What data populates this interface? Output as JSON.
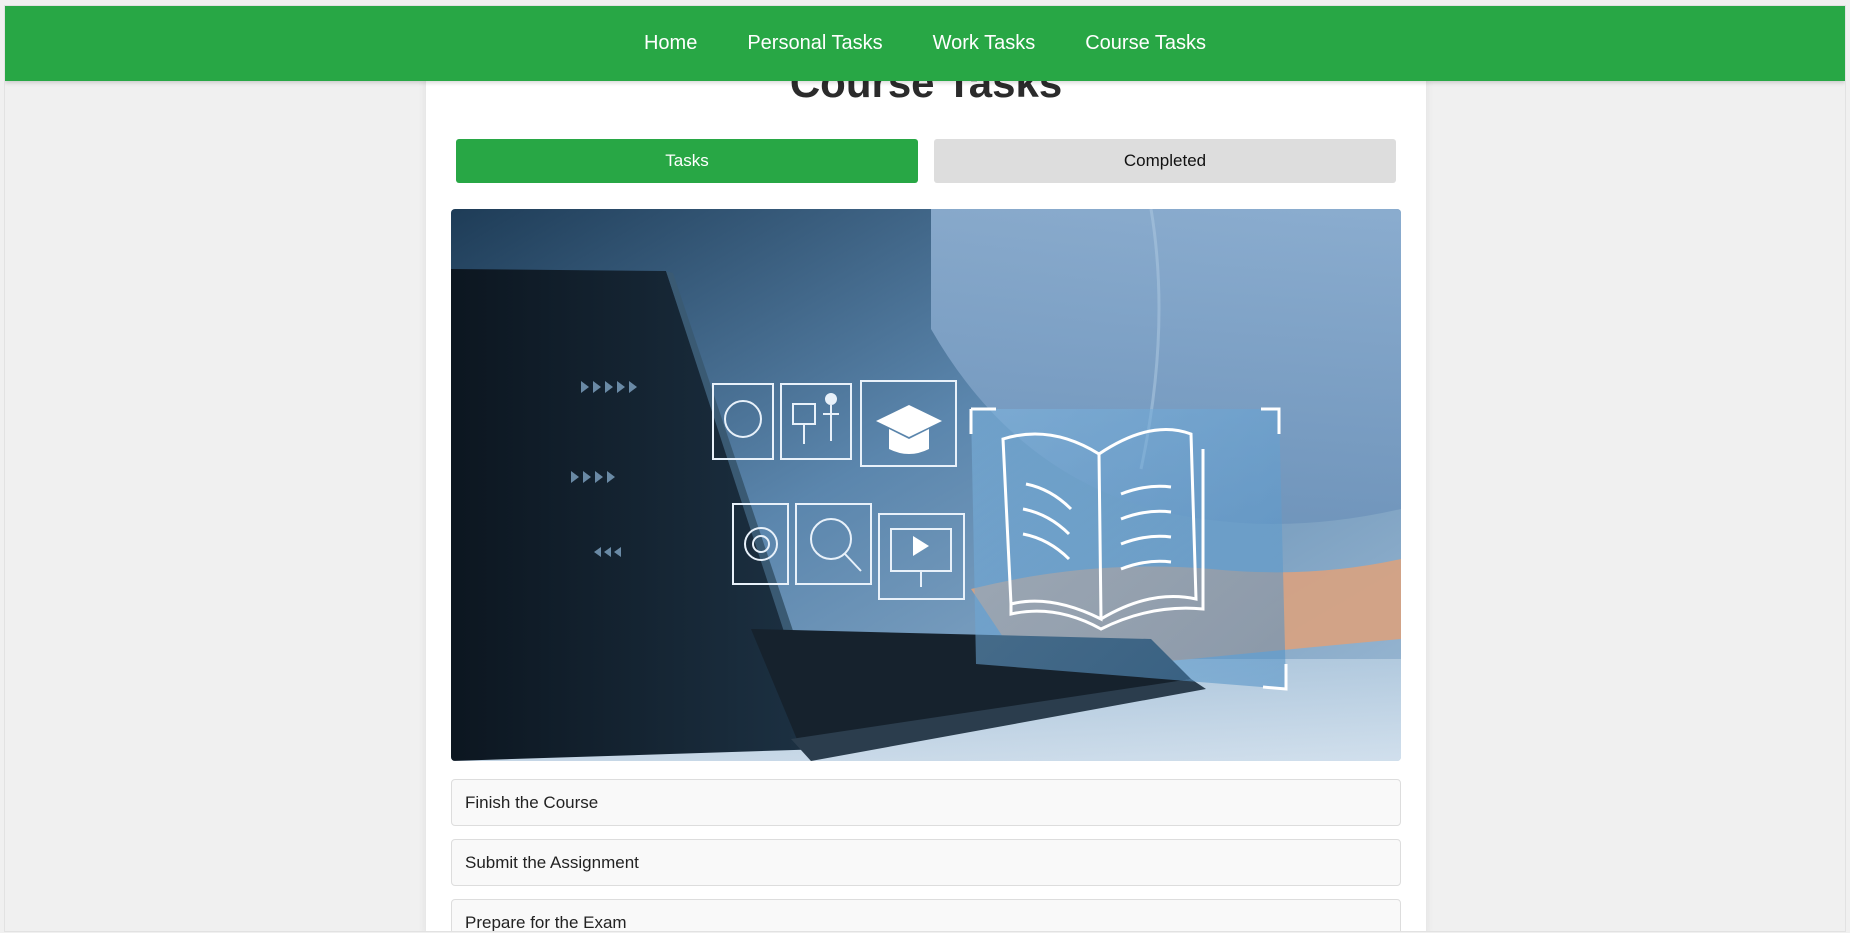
{
  "nav": {
    "items": [
      {
        "label": "Home"
      },
      {
        "label": "Personal Tasks"
      },
      {
        "label": "Work Tasks"
      },
      {
        "label": "Course Tasks"
      }
    ]
  },
  "page": {
    "title": "Course Tasks"
  },
  "tabs": {
    "tasks_label": "Tasks",
    "completed_label": "Completed",
    "active": "Tasks"
  },
  "hero": {
    "icon_names": [
      "head-gears-icon",
      "presenter-icon",
      "graduation-cap-icon",
      "book-icon",
      "target-icon",
      "magnifier-icon",
      "monitor-play-icon"
    ]
  },
  "tasks": [
    {
      "label": "Finish the Course"
    },
    {
      "label": "Submit the Assignment"
    },
    {
      "label": "Prepare for the Exam"
    }
  ],
  "colors": {
    "accent": "#28a745",
    "tab_inactive": "#dddddd",
    "background": "#f0f0f0"
  }
}
